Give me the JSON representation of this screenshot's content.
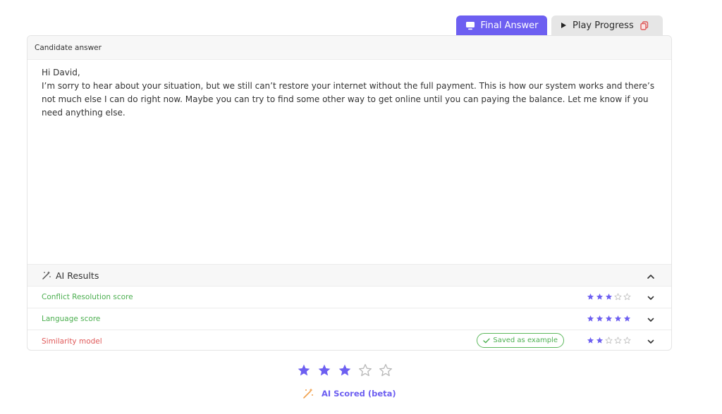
{
  "tabs": {
    "final_answer": "Final Answer",
    "play_progress": "Play Progress"
  },
  "card": {
    "header": "Candidate answer",
    "greeting": "Hi David,",
    "body": "I’m sorry to hear about your situation, but we still can’t restore your internet without the full payment. This is how our system works and there’s not much else I can do right now. Maybe you can try to find some other way to get online until you can paying the balance. Let me know if you need anything else."
  },
  "ai_results": {
    "title": "AI Results",
    "rows": [
      {
        "label": "Conflict Resolution score",
        "rating": 3,
        "max": 5
      },
      {
        "label": "Language score",
        "rating": 5,
        "max": 5
      },
      {
        "label": "Similarity model",
        "rating": 2,
        "max": 5,
        "badge": "Saved as example"
      }
    ]
  },
  "overall": {
    "rating": 3,
    "max": 5,
    "label": "AI Scored (beta)"
  },
  "colors": {
    "accent": "#6d5ff1",
    "green": "#4caf50",
    "red": "#e05a5a",
    "star_filled": "#6d5ff1",
    "star_empty": "#b9b9b9"
  }
}
